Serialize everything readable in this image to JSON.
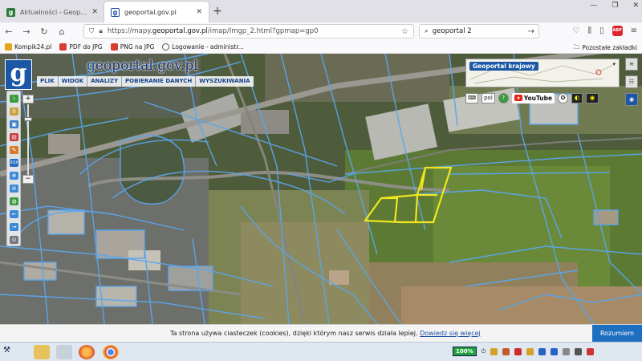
{
  "browser": {
    "tabs": [
      {
        "label": "Aktualności - Geoportal Krajowy",
        "active": false
      },
      {
        "label": "geoportal.gov.pl",
        "active": true
      }
    ],
    "url_prefix": "https://mapy.",
    "url_host": "geoportal.gov.pl",
    "url_path": "/imap/Imgp_2.html?gpmap=gp0",
    "search_value": "geoportal 2",
    "bookmarks": [
      {
        "label": "Kompik24.pl",
        "color": "#e8a317"
      },
      {
        "label": "PDF do JPG",
        "color": "#d93b2f"
      },
      {
        "label": "PNG na JPG",
        "color": "#d93b2f"
      },
      {
        "label": "Logowanie - administr...",
        "color": "#555555"
      }
    ],
    "other_bookmarks": "Pozostałe zakładki"
  },
  "geoportal": {
    "logo_letter": "g",
    "brand_prefix": "g",
    "brand_rest": "eoportal.gov.pl",
    "menu": [
      "PLIK",
      "WIDOK",
      "ANALIZY",
      "POBIERANIE DANYCH",
      "WYSZUKIWANIA"
    ],
    "overview_title": "Geoportal krajowy",
    "language": "pol",
    "youtube_label": "YouTube",
    "zoom_plus": "+",
    "zoom_minus": "−"
  },
  "cookie": {
    "text": "Ta strona używa ciasteczek (cookies), dzięki którym nasz serwis działa lepiej.",
    "link": "Dowiedz się więcej",
    "button": "Rozumiem"
  },
  "taskbar": {
    "battery": "100%"
  },
  "colors": {
    "parcel_lines": "#5aa6ee",
    "selected_parcels": "#f2e51f",
    "geoportal_blue": "#1c57a5"
  }
}
